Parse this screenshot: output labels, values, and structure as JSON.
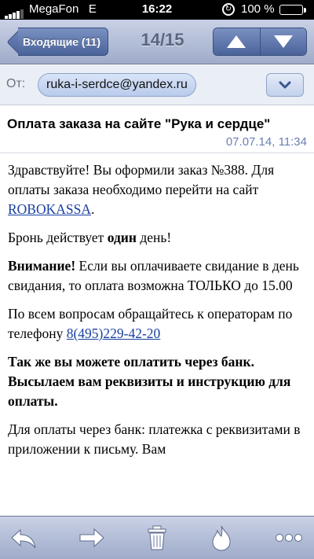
{
  "status_bar": {
    "carrier": "MegaFon",
    "network": "E",
    "time": "16:22",
    "battery_percent": "100 %",
    "battery_level": 1.0,
    "battery_color": "#4cd964"
  },
  "nav": {
    "back_label": "Входящие (11)",
    "counter": "14/15",
    "prev_icon": "up-arrow-icon",
    "next_icon": "down-arrow-icon"
  },
  "header": {
    "from_label": "От:",
    "from_address": "ruka-i-serdce@yandex.ru",
    "expand_icon": "chevron-down-icon",
    "subject": "Оплата заказа на сайте \"Рука и сердце\"",
    "date": "07.07.14, 11:34"
  },
  "body": {
    "p1_text": "Здравствуйте! Вы оформили заказ №388. Для оплаты заказа необходимо перейти на сайт ",
    "p1_link": "ROBOKASSA",
    "p1_end": ".",
    "p2_pre": "Бронь действует ",
    "p2_bold": "один",
    "p2_post": " день!",
    "p3_bold": "Внимание!",
    "p3_text": " Если вы оплачиваете свидание в день свидания, то оплата возможна ТОЛЬКО до 15.00",
    "p4_text": "По всем вопросам обращайтесь к операторам по телефону ",
    "p4_phone": "8(495)229-42-20",
    "p5_bold": "Так же вы можете оплатить через банк. Высылаем вам реквизиты и инструкцию для оплаты.",
    "p6_text": "Для оплаты через банк: платежка с реквизитами в приложении к письму. Вам"
  },
  "toolbar": {
    "items": [
      "reply-icon",
      "forward-icon",
      "trash-icon",
      "flame-icon",
      "more-icon"
    ]
  },
  "colors": {
    "bar_gradient_top": "#c9d1e6",
    "bar_gradient_bottom": "#9fabc9",
    "button_blue": "#4a639a",
    "link": "#1a3fa0",
    "date": "#6a7fb5"
  }
}
